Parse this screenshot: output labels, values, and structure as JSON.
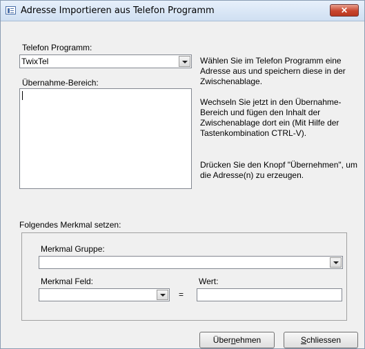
{
  "window": {
    "title": "Adresse Importieren aus Telefon Programm",
    "close_label": "✕"
  },
  "phone_program": {
    "label": "Telefon Programm:",
    "selected": "TwixTel"
  },
  "import_area": {
    "label": "Übernahme-Bereich:",
    "value": ""
  },
  "help_text": {
    "p1": "Wählen Sie im Telefon Programm eine Adresse aus und speichern diese in der Zwischenablage.",
    "p2": "Wechseln Sie jetzt in den Übernahme-Bereich und fügen den Inhalt der Zwischenablage dort ein (Mit Hilfe der Tastenkombination CTRL-V).",
    "p3": "Drücken Sie den Knopf \"Übernehmen\", um die Adresse(n) zu erzeugen."
  },
  "feature": {
    "section_label": "Folgendes Merkmal setzen:",
    "group_label": "Merkmal Gruppe:",
    "group_value": "",
    "field_label": "Merkmal Feld:",
    "field_value": "",
    "equals": "=",
    "value_label": "Wert:",
    "value_value": ""
  },
  "buttons": {
    "apply_pre": "Über",
    "apply_acc": "n",
    "apply_post": "ehmen",
    "close_pre": "",
    "close_acc": "S",
    "close_post": "chliessen"
  }
}
